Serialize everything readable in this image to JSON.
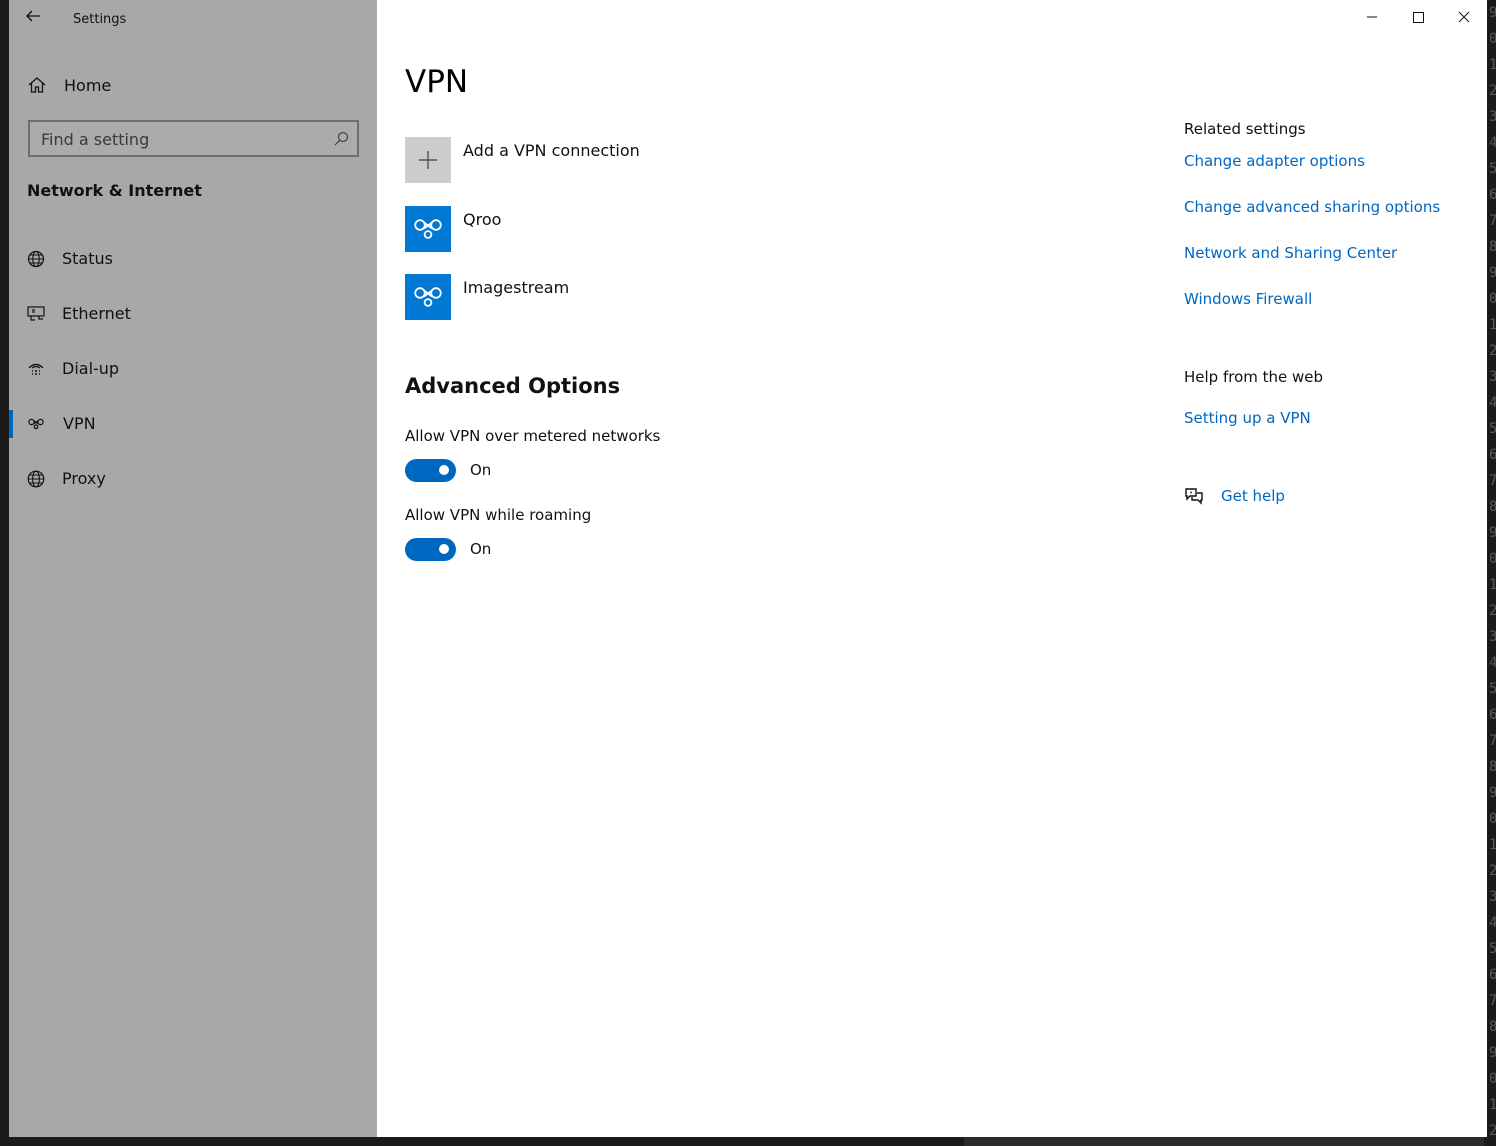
{
  "window": {
    "app_title": "Settings",
    "controls": {
      "minimize": "minimize",
      "maximize": "maximize",
      "close": "close"
    }
  },
  "sidebar": {
    "home_label": "Home",
    "search_placeholder": "Find a setting",
    "section_title": "Network & Internet",
    "items": [
      {
        "label": "Status",
        "icon": "globe-status-icon",
        "selected": false
      },
      {
        "label": "Ethernet",
        "icon": "ethernet-icon",
        "selected": false
      },
      {
        "label": "Dial-up",
        "icon": "dialup-icon",
        "selected": false
      },
      {
        "label": "VPN",
        "icon": "vpn-icon",
        "selected": true
      },
      {
        "label": "Proxy",
        "icon": "globe-icon",
        "selected": false
      }
    ]
  },
  "main": {
    "title": "VPN",
    "add_connection_label": "Add a VPN connection",
    "connections": [
      {
        "name": "Qroo",
        "icon": "vpn-icon"
      },
      {
        "name": "Imagestream",
        "icon": "vpn-icon"
      }
    ],
    "advanced_title": "Advanced Options",
    "options": [
      {
        "label": "Allow VPN over metered networks",
        "state": "On",
        "enabled": true
      },
      {
        "label": "Allow VPN while roaming",
        "state": "On",
        "enabled": true
      }
    ]
  },
  "related": {
    "title": "Related settings",
    "links": [
      "Change adapter options",
      "Change advanced sharing options",
      "Network and Sharing Center",
      "Windows Firewall"
    ]
  },
  "help": {
    "title": "Help from the web",
    "link": "Setting up a VPN",
    "get_help_label": "Get help"
  },
  "colors": {
    "accent": "#0067c0",
    "tile_blue": "#0078d4",
    "sidebar_bg": "#a8a8a8"
  },
  "background_digits": [
    "9",
    "0",
    "1",
    "2",
    "3",
    "4",
    "5",
    "6",
    "7",
    "8",
    "9",
    "0",
    "1",
    "2",
    "3",
    "4",
    "5",
    "6",
    "7",
    "8",
    "9",
    "0",
    "1",
    "2",
    "3",
    "4",
    "5",
    "6",
    "7",
    "8",
    "9",
    "0",
    "1",
    "2",
    "3",
    "4",
    "5",
    "6",
    "7",
    "8",
    "9",
    "0",
    "1",
    "2"
  ]
}
